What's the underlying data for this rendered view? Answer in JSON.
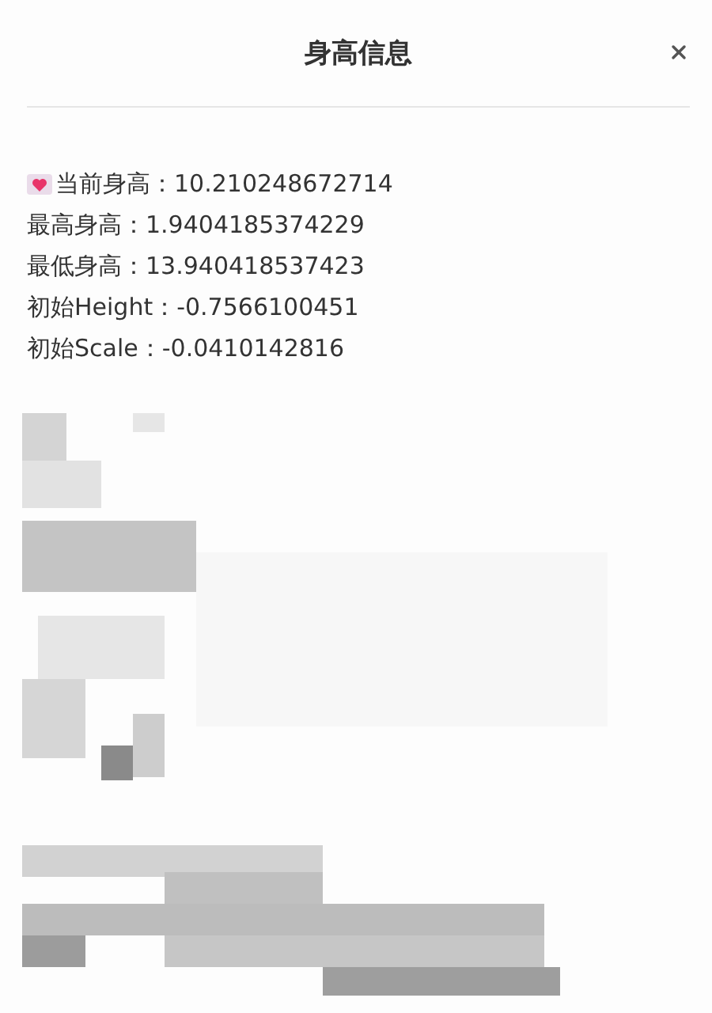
{
  "dialog": {
    "title": "身高信息"
  },
  "info_lines": [
    {
      "text": "当前身高：10.210248672714",
      "kind": "heart"
    },
    {
      "text": "最高身高：1.9404185374229",
      "kind": "plain"
    },
    {
      "text": "最低身高：13.940418537423",
      "kind": "plain"
    },
    {
      "text": "初始Height：-0.7566100451",
      "kind": "plain"
    },
    {
      "text": "初始Scale：-0.0410142816",
      "kind": "plain"
    }
  ]
}
